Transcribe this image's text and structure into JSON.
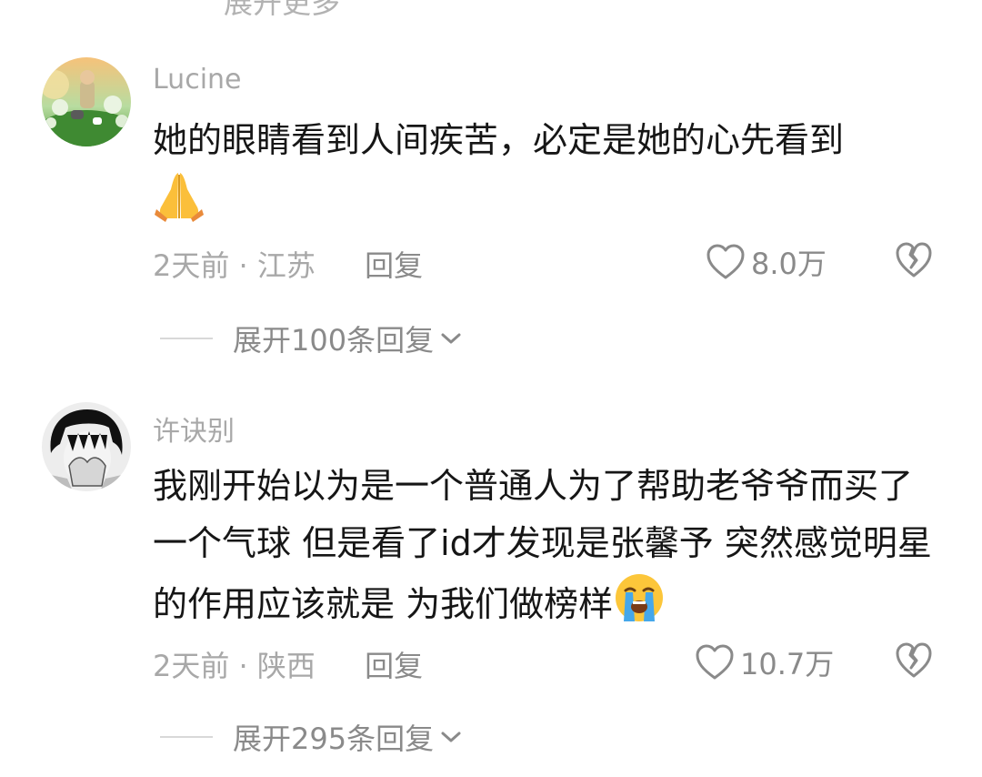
{
  "top_cutoff_text": "展开更多",
  "comments": [
    {
      "username": "Lucine",
      "text": "她的眼睛看到人间疾苦，必定是她的心先看到",
      "emoji": "praying-hands",
      "time": "2天前",
      "location": "江苏",
      "reply_label": "回复",
      "likes": "8.0万",
      "expand_label": "展开100条回复"
    },
    {
      "username": "许诀别",
      "text": "我刚开始以为是一个普通人为了帮助老爷爷而买了一个气球 但是看了id才发现是张馨予 突然感觉明星的作用应该就是 为我们做榜样",
      "emoji": "loudly-crying-face",
      "time": "2天前",
      "location": "陕西",
      "reply_label": "回复",
      "likes": "10.7万",
      "expand_label": "展开295条回复"
    }
  ],
  "separator": "·",
  "icons": {
    "like": "heart-outline-icon",
    "dislike": "broken-heart-icon",
    "expand": "chevron-down-icon"
  },
  "colors": {
    "text_primary": "#161616",
    "text_secondary": "#a8a8a8",
    "icon_gray": "#8a8a8a"
  }
}
